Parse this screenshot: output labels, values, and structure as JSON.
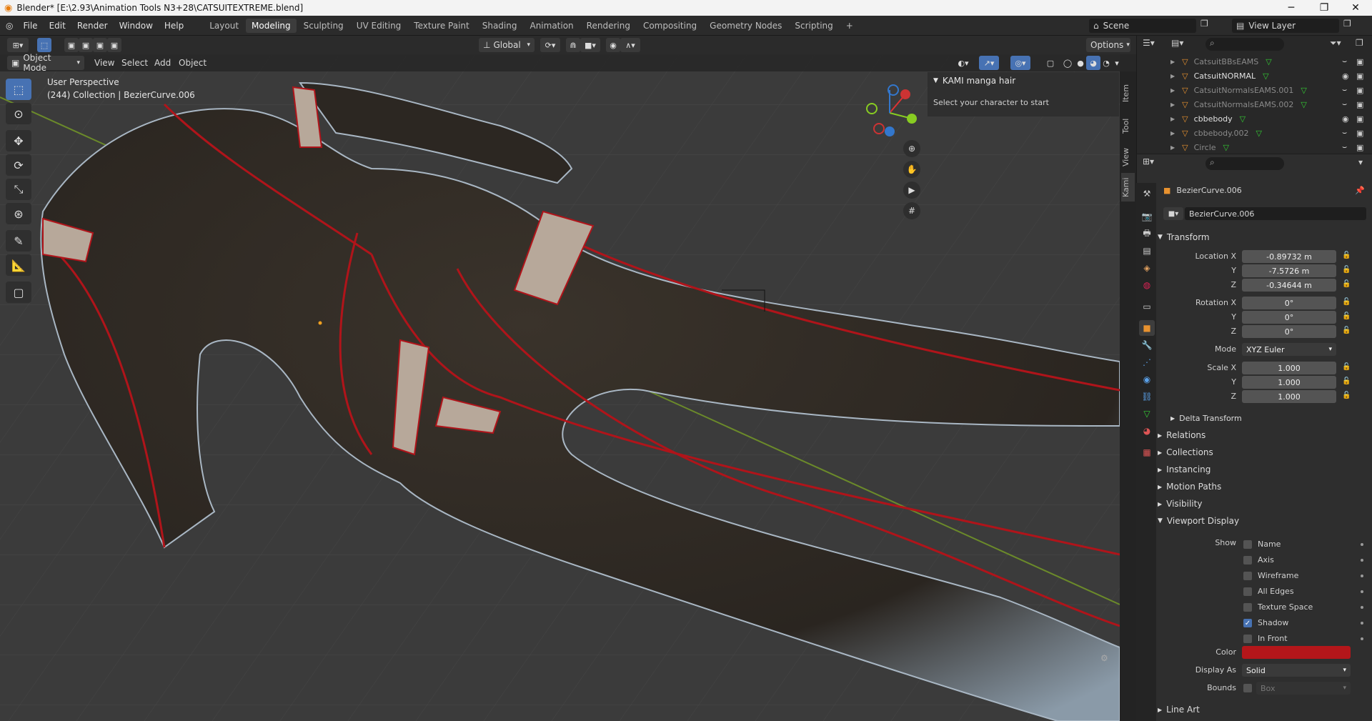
{
  "window": {
    "title": "Blender* [E:\\2.93\\Animation Tools N3+28\\CATSUITEXTREME.blend]"
  },
  "menu": [
    "File",
    "Edit",
    "Render",
    "Window",
    "Help"
  ],
  "workspaces": [
    "Layout",
    "Modeling",
    "Sculpting",
    "UV Editing",
    "Texture Paint",
    "Shading",
    "Animation",
    "Rendering",
    "Compositing",
    "Geometry Nodes",
    "Scripting"
  ],
  "active_workspace": "Modeling",
  "scene": {
    "name": "Scene",
    "view_layer": "View Layer"
  },
  "header": {
    "orientation": "Global",
    "options": "Options",
    "mode": "Object Mode",
    "menus": [
      "View",
      "Select",
      "Add",
      "Object"
    ]
  },
  "viewport": {
    "perspective": "User Perspective",
    "collection": "(244) Collection | BezierCurve.006"
  },
  "npanel": {
    "title": "KAMI manga hair",
    "text": "Select your character to start",
    "tabs": [
      "Item",
      "Tool",
      "View",
      "Kami"
    ]
  },
  "outliner": {
    "rows": [
      {
        "name": "CatsuitBBsEAMS",
        "dim": true
      },
      {
        "name": "CatsuitNORMAL",
        "dim": false
      },
      {
        "name": "CatsuitNormalsEAMS.001",
        "dim": true
      },
      {
        "name": "CatsuitNormalsEAMS.002",
        "dim": true
      },
      {
        "name": "cbbebody",
        "dim": false
      },
      {
        "name": "cbbebody.002",
        "dim": true
      },
      {
        "name": "Circle",
        "dim": true
      }
    ]
  },
  "properties": {
    "object_name": "BezierCurve.006",
    "data_name": "BezierCurve.006",
    "transform": {
      "title": "Transform",
      "location_label": "Location X",
      "location": [
        "-0.89732 m",
        "-7.5726 m",
        "-0.34644 m"
      ],
      "rotation_label": "Rotation X",
      "rotation": [
        "0°",
        "0°",
        "0°"
      ],
      "mode_label": "Mode",
      "mode": "XYZ Euler",
      "scale_label": "Scale X",
      "scale": [
        "1.000",
        "1.000",
        "1.000"
      ],
      "y": "Y",
      "z": "Z",
      "delta": "Delta Transform"
    },
    "sections": [
      "Relations",
      "Collections",
      "Instancing",
      "Motion Paths",
      "Visibility"
    ],
    "viewport_display": {
      "title": "Viewport Display",
      "show_label": "Show",
      "options": [
        {
          "label": "Name",
          "checked": false
        },
        {
          "label": "Axis",
          "checked": false
        },
        {
          "label": "Wireframe",
          "checked": false
        },
        {
          "label": "All Edges",
          "checked": false
        },
        {
          "label": "Texture Space",
          "checked": false
        },
        {
          "label": "Shadow",
          "checked": true
        },
        {
          "label": "In Front",
          "checked": false
        }
      ],
      "color_label": "Color",
      "color": "#b4161a",
      "display_as_label": "Display As",
      "display_as": "Solid",
      "bounds_label": "Bounds",
      "bounds": "Box"
    },
    "line_art": "Line Art"
  }
}
